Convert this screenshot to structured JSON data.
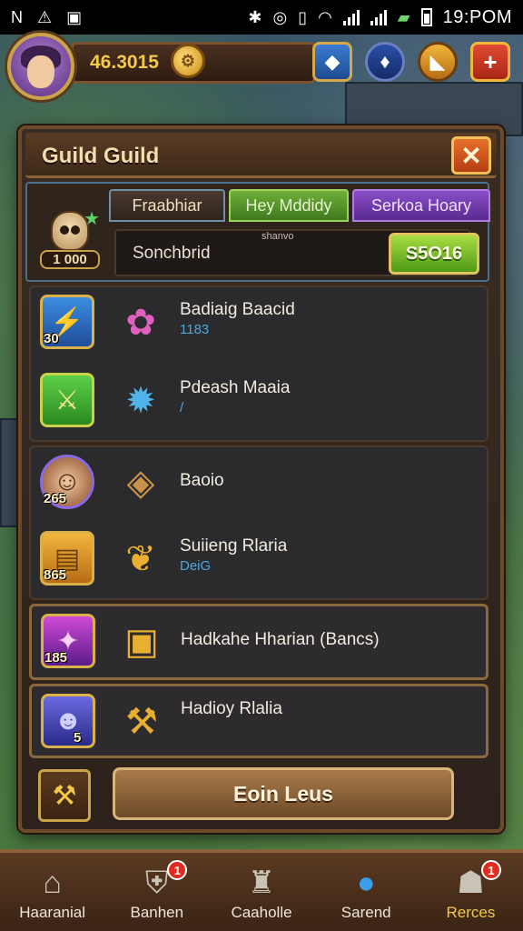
{
  "status_bar": {
    "time": "19:POM",
    "icons": [
      "notification-n-icon",
      "warning-triangle-icon",
      "image-icon",
      "bluetooth-icon",
      "alarm-icon",
      "vibrate-icon",
      "wifi-icon",
      "signal-icon",
      "battery-saver-icon",
      "battery-icon"
    ]
  },
  "hud": {
    "gold_amount": "46.3015",
    "buttons": [
      "blue-gem-icon",
      "crystal-icon",
      "gold-shard-icon",
      "plus-icon"
    ]
  },
  "panel": {
    "title": "Guild Guild",
    "close_label": "✕",
    "badge_number": "1 000",
    "tabs": [
      "Fraabhiar",
      "Hey Mddidy",
      "Serkoa Hoary"
    ],
    "search": {
      "value": "Sonchbrid",
      "hint": "shanvo",
      "button_label": "S5O16"
    },
    "rows": [
      {
        "title": "Badiaig Baacid",
        "subtitle": "1183",
        "num": "30",
        "icon": "lightning-scroll-icon",
        "category_icon": "pink-lotus-icon"
      },
      {
        "title": "Pdeash Maaia",
        "subtitle": "/",
        "num": "",
        "icon": "green-sword-icon",
        "category_icon": "blue-spirit-icon"
      },
      {
        "title": "Baoio",
        "subtitle": "",
        "num": "265",
        "icon": "hero-portrait-icon",
        "category_icon": "diamond-emblem-icon"
      },
      {
        "title": "Suiieng Rlaria",
        "subtitle": "DeiG",
        "num": "865",
        "icon": "treasure-chest-icon",
        "category_icon": "gold-wing-icon"
      },
      {
        "title": "Hadkahe Hharian (Bancs)",
        "subtitle": "",
        "num": "185",
        "icon": "magic-flame-icon",
        "category_icon": "gold-chest-icon"
      },
      {
        "title": "Hadioy Rlalia",
        "subtitle": "",
        "num": "5",
        "icon": "demon-portrait-icon",
        "category_icon": "gold-hammer-icon"
      }
    ],
    "join_label": "Eoin Leus"
  },
  "bottom_nav": [
    {
      "label": "Haaranial",
      "icon": "house-icon",
      "badge": ""
    },
    {
      "label": "Banhen",
      "icon": "shield-heart-icon",
      "badge": "1"
    },
    {
      "label": "Caaholle",
      "icon": "castle-icon",
      "badge": ""
    },
    {
      "label": "Sarend",
      "icon": "chat-bubble-icon",
      "badge": ""
    },
    {
      "label": "Rerces",
      "icon": "team-icon",
      "badge": "1"
    }
  ],
  "colors": {
    "accent_gold": "#f3c94a",
    "tab_green": "#6fae3a",
    "tab_purple": "#8a4fc9",
    "close_orange": "#e8702c",
    "link_blue": "#4ea8e0"
  }
}
